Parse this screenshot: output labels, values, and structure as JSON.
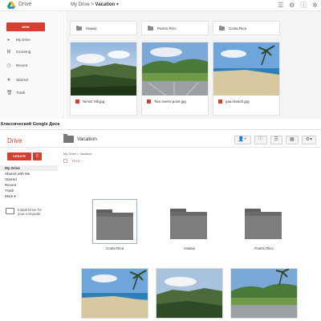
{
  "new_drive": {
    "app_name": "Drive",
    "breadcrumb": {
      "root": "My Drive",
      "separator": ">",
      "current": "Vacation",
      "arrow": "▾"
    },
    "toolbar_icons": [
      "list-view-icon",
      "gear-icon",
      "info-icon",
      "settings-icon"
    ],
    "new_button": "NEW",
    "nav": [
      {
        "icon": "my-drive-icon",
        "label": "My Drive"
      },
      {
        "icon": "incoming-icon",
        "label": "Incoming"
      },
      {
        "icon": "recent-icon",
        "label": "Recent"
      },
      {
        "icon": "starred-icon",
        "label": "Starred"
      },
      {
        "icon": "trash-icon",
        "label": "Trash"
      }
    ],
    "folders": [
      "Hawaii",
      "Puerto Rico",
      "Costa Rica"
    ],
    "files": [
      "Nimitz Hill.jpg",
      "Two lovers point.jpg",
      "Ipau beach.jpg"
    ]
  },
  "section_label": "Классический Google Диск",
  "classic_drive": {
    "title": "Drive",
    "header_title": "Vacation",
    "create_button": "CREATE",
    "upload_icon": "upload-icon",
    "breadcrumb": "My Drive > Vacation",
    "sort_label": "TITLE ↑",
    "tools": [
      "add-person-icon",
      "info-icon",
      "list-view-icon",
      "grid-view-icon",
      "gear-icon"
    ],
    "nav": [
      "My Drive",
      "Shared with Me",
      "Starred",
      "Recent",
      "Trash",
      "More ▾"
    ],
    "install_text_1": "Install Drive for",
    "install_text_2": "your computer",
    "folders": [
      "Costa Rica",
      "Hawaii",
      "Puerto Rico"
    ]
  },
  "colors": {
    "accent_red": "#d23f31",
    "selection_blue": "#8fb3e6"
  }
}
